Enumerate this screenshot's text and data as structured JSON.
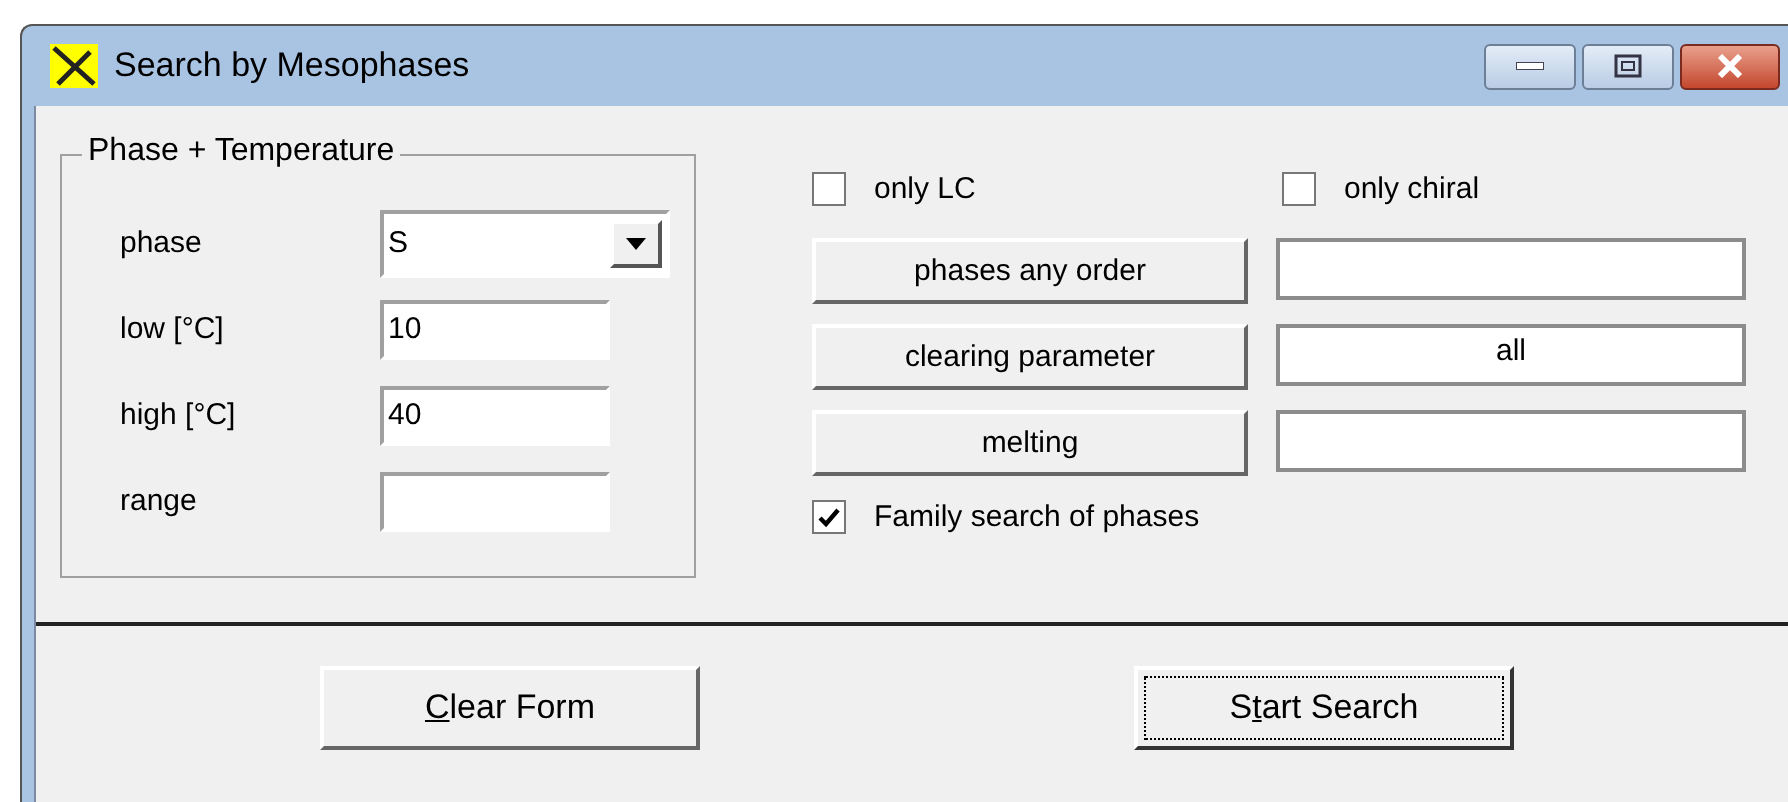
{
  "window": {
    "title": "Search by Mesophases"
  },
  "group": {
    "title": "Phase + Temperature",
    "fields": [
      {
        "kind": "combo",
        "label": "phase",
        "value": "S"
      },
      {
        "kind": "text",
        "label": "low [°C]",
        "value": "10"
      },
      {
        "kind": "text",
        "label": "high [°C]",
        "value": "40"
      },
      {
        "kind": "text",
        "label": "range"
      }
    ]
  },
  "options": [
    {
      "label": "only LC",
      "checked": false
    },
    {
      "label": "only chiral",
      "checked": false
    }
  ],
  "criteria": [
    {
      "button": "phases any order"
    },
    {
      "button": "clearing parameter",
      "value": "all"
    },
    {
      "button": "melting"
    }
  ],
  "family": {
    "label": "Family search of phases",
    "checked": true
  },
  "buttons": [
    {
      "access_key": "C",
      "after": "lear Form",
      "focused": false
    },
    {
      "before": "S",
      "access_key": "t",
      "after": "art Search",
      "focused": true
    }
  ]
}
